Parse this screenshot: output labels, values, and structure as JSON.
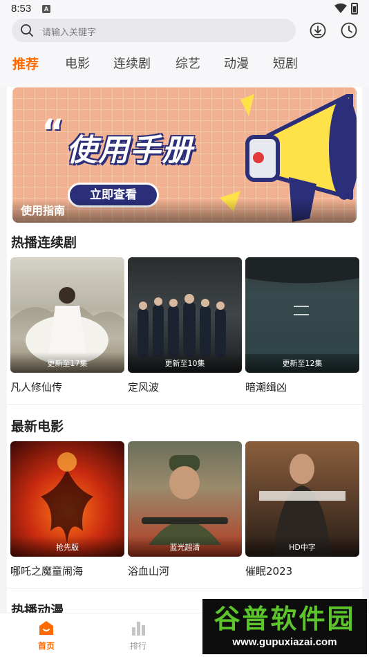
{
  "status_bar": {
    "time": "8:53",
    "notification_badge": "A"
  },
  "search": {
    "placeholder": "请输入关键字"
  },
  "toolbar": {
    "download_icon": "download-icon",
    "history_icon": "clock-icon"
  },
  "tabs": [
    {
      "label": "推荐",
      "active": true
    },
    {
      "label": "电影",
      "active": false
    },
    {
      "label": "连续剧",
      "active": false
    },
    {
      "label": "综艺",
      "active": false
    },
    {
      "label": "动漫",
      "active": false
    },
    {
      "label": "短剧",
      "active": false
    }
  ],
  "banner": {
    "title": "使用手册",
    "cta": "立即查看",
    "caption": "使用指南"
  },
  "sections": [
    {
      "title": "热播连续剧",
      "items": [
        {
          "name": "凡人修仙传",
          "badge": "更新至17集"
        },
        {
          "name": "定风波",
          "badge": "更新至10集"
        },
        {
          "name": "暗潮缉凶",
          "badge": "更新至12集"
        }
      ]
    },
    {
      "title": "最新电影",
      "items": [
        {
          "name": "哪吒之魔童闹海",
          "badge": "抢先版"
        },
        {
          "name": "浴血山河",
          "badge": "蓝光超清"
        },
        {
          "name": "催眠2023",
          "badge": "HD中字"
        }
      ]
    },
    {
      "title": "热播动漫",
      "items": []
    }
  ],
  "bottom_nav": [
    {
      "label": "首页",
      "active": true
    },
    {
      "label": "排行",
      "active": false
    }
  ],
  "watermark": {
    "logo": "谷普软件园",
    "url": "www.gupuxiazai.com"
  },
  "colors": {
    "accent": "#ff6a00",
    "banner_bg": "#f2b190",
    "banner_navy": "#2b2f7a",
    "watermark_green": "#5cc52c"
  }
}
